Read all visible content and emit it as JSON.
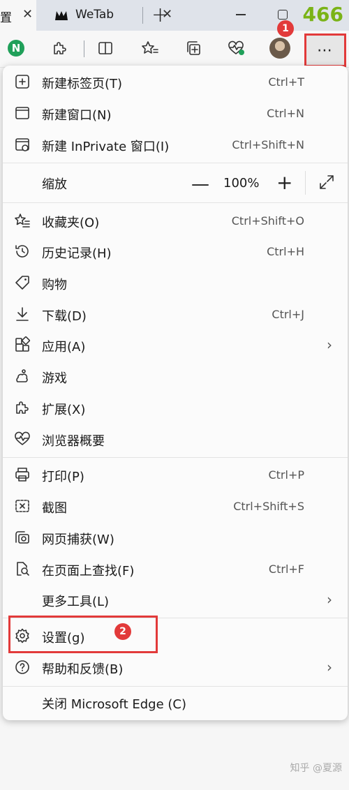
{
  "tabs": [
    {
      "label": "置",
      "close": "✕"
    },
    {
      "label": "WeTab",
      "close": "✕"
    }
  ],
  "newtab_symbol": "+",
  "counter": "466",
  "toolbar": {
    "extension_letter": "N",
    "more_symbol": "⋯"
  },
  "badges": [
    "1",
    "2"
  ],
  "menu": {
    "new_tab": {
      "label": "新建标签页(T)",
      "shortcut": "Ctrl+T"
    },
    "new_window": {
      "label": "新建窗口(N)",
      "shortcut": "Ctrl+N"
    },
    "new_inprivate": {
      "label": "新建 InPrivate 窗口(I)",
      "shortcut": "Ctrl+Shift+N"
    },
    "zoom": {
      "label": "缩放",
      "minus": "—",
      "value": "100%",
      "plus": "+"
    },
    "favorites": {
      "label": "收藏夹(O)",
      "shortcut": "Ctrl+Shift+O"
    },
    "history": {
      "label": "历史记录(H)",
      "shortcut": "Ctrl+H"
    },
    "shopping": {
      "label": "购物"
    },
    "downloads": {
      "label": "下载(D)",
      "shortcut": "Ctrl+J"
    },
    "apps": {
      "label": "应用(A)",
      "chevron": "›"
    },
    "games": {
      "label": "游戏"
    },
    "extensions": {
      "label": "扩展(X)"
    },
    "browser_essentials": {
      "label": "浏览器概要"
    },
    "print": {
      "label": "打印(P)",
      "shortcut": "Ctrl+P"
    },
    "screenshot": {
      "label": "截图",
      "shortcut": "Ctrl+Shift+S"
    },
    "web_capture": {
      "label": "网页捕获(W)"
    },
    "find": {
      "label": "在页面上查找(F)",
      "shortcut": "Ctrl+F"
    },
    "more_tools": {
      "label": "更多工具(L)",
      "chevron": "›"
    },
    "settings": {
      "label": "设置(g)"
    },
    "help": {
      "label": "帮助和反馈(B)",
      "chevron": "›"
    },
    "close": {
      "label": "关闭 Microsoft Edge (C)"
    }
  },
  "watermark": "知乎 @夏源",
  "colors": {
    "highlight": "#e23a3a",
    "counter": "#7ab317",
    "extension": "#20a05a"
  }
}
